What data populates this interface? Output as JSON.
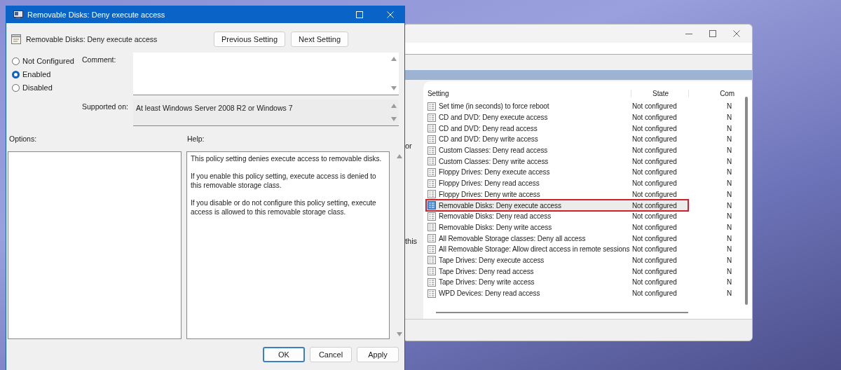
{
  "background_window": {
    "side_fragments": [
      {
        "text": "or"
      },
      {
        "text": "this"
      }
    ],
    "table": {
      "columns": [
        {
          "label": "Setting"
        },
        {
          "label": "State"
        },
        {
          "label": "Com"
        }
      ],
      "rows": [
        {
          "setting": "Set time (in seconds) to force reboot",
          "state": "Not configured",
          "column_3": "N",
          "selected": false
        },
        {
          "setting": "CD and DVD: Deny execute access",
          "state": "Not configured",
          "column_3": "N",
          "selected": false
        },
        {
          "setting": "CD and DVD: Deny read access",
          "state": "Not configured",
          "column_3": "N",
          "selected": false
        },
        {
          "setting": "CD and DVD: Deny write access",
          "state": "Not configured",
          "column_3": "N",
          "selected": false
        },
        {
          "setting": "Custom Classes: Deny read access",
          "state": "Not configured",
          "column_3": "N",
          "selected": false
        },
        {
          "setting": "Custom Classes: Deny write access",
          "state": "Not configured",
          "column_3": "N",
          "selected": false
        },
        {
          "setting": "Floppy Drives: Deny execute access",
          "state": "Not configured",
          "column_3": "N",
          "selected": false
        },
        {
          "setting": "Floppy Drives: Deny read access",
          "state": "Not configured",
          "column_3": "N",
          "selected": false
        },
        {
          "setting": "Floppy Drives: Deny write access",
          "state": "Not configured",
          "column_3": "N",
          "selected": false
        },
        {
          "setting": "Removable Disks: Deny execute access",
          "state": "Not configured",
          "column_3": "N",
          "selected": true
        },
        {
          "setting": "Removable Disks: Deny read access",
          "state": "Not configured",
          "column_3": "N",
          "selected": false
        },
        {
          "setting": "Removable Disks: Deny write access",
          "state": "Not configured",
          "column_3": "N",
          "selected": false
        },
        {
          "setting": "All Removable Storage classes: Deny all access",
          "state": "Not configured",
          "column_3": "N",
          "selected": false
        },
        {
          "setting": "All Removable Storage: Allow direct access in remote sessions",
          "state": "Not configured",
          "column_3": "N",
          "selected": false
        },
        {
          "setting": "Tape Drives: Deny execute access",
          "state": "Not configured",
          "column_3": "N",
          "selected": false
        },
        {
          "setting": "Tape Drives: Deny read access",
          "state": "Not configured",
          "column_3": "N",
          "selected": false
        },
        {
          "setting": "Tape Drives: Deny write access",
          "state": "Not configured",
          "column_3": "N",
          "selected": false
        },
        {
          "setting": "WPD Devices: Deny read access",
          "state": "Not configured",
          "column_3": "N",
          "selected": false
        }
      ]
    }
  },
  "dialog": {
    "window": {
      "title": "Removable Disks: Deny execute access"
    },
    "policy_name": "Removable Disks: Deny execute access",
    "nav_buttons": [
      "Previous Setting",
      "Next Setting"
    ],
    "options": [
      {
        "label": "Not Configured",
        "selected": false
      },
      {
        "label": "Enabled",
        "selected": true
      },
      {
        "label": "Disabled",
        "selected": false
      }
    ],
    "comment_label": "Comment:",
    "supported_label": "Supported on:",
    "supported_value": "At least Windows Server 2008 R2 or Windows 7",
    "options_label": "Options:",
    "help_label": "Help:",
    "help_paragraphs": [
      "This policy setting denies execute access to removable disks.",
      "If you enable this policy setting, execute access is denied to this removable storage class.",
      "If you disable or do not configure this policy setting, execute access is allowed to this removable storage class."
    ],
    "buttons": [
      "OK",
      "Cancel",
      "Apply"
    ]
  }
}
